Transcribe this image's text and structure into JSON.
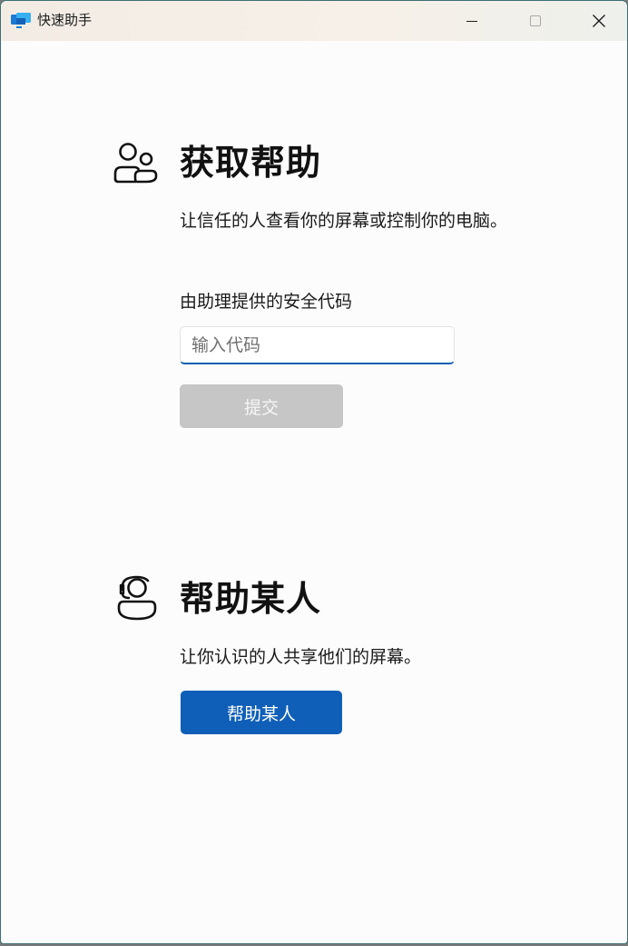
{
  "window": {
    "title": "快速助手",
    "controls": [
      "minimize",
      "maximize",
      "close"
    ]
  },
  "get_help": {
    "icon": "people-icon",
    "heading": "获取帮助",
    "description": "让信任的人查看你的屏幕或控制你的电脑。",
    "field_label": "由助理提供的安全代码",
    "input_placeholder": "输入代码",
    "input_value": "",
    "submit_label": "提交"
  },
  "help_someone": {
    "icon": "headset-person-icon",
    "heading": "帮助某人",
    "description": "让你认识的人共享他们的屏幕。",
    "button_label": "帮助某人"
  },
  "colors": {
    "accent": "#0f5fb8",
    "disabled_button": "#c6c6c6",
    "input_underline": "#0f5fae"
  }
}
